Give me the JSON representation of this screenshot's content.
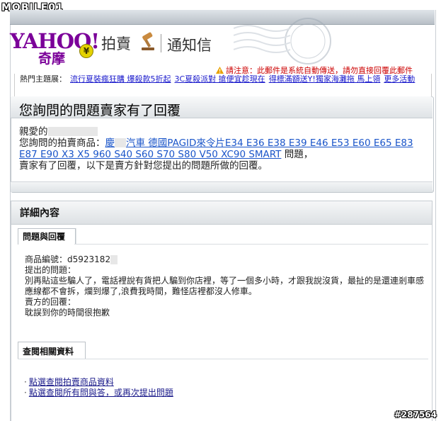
{
  "watermark": {
    "top": "MOBILE01",
    "bottom": "#287564"
  },
  "header": {
    "logo_text": "YAHOO!",
    "logo_cn": "奇摩",
    "logo_badge": "¥",
    "title_1": "拍賣",
    "title_2": "通知信",
    "notice": "請注意：此郵件是系統自動傳送，請勿直接回覆此郵件"
  },
  "hot_topics": {
    "label": "熱門主題展：",
    "links": [
      "流行夏裝瘋狂購 爆殺款5折起",
      "3C夏殺派對 搶便宜趁現在",
      "得標滿額送Y!獨家海灘拖 馬上領"
    ],
    "more": "更多活動"
  },
  "panel1": {
    "title": "您詢問的問題賣家有了回覆",
    "greeting": "親愛的",
    "line2_prefix": "您詢問的拍賣商品：",
    "item_link_a": "慶",
    "item_link_b": "汽車 德國PAGID來令片E34 E36 E38 E39 E46 E53 E60 E65 E83 E87 E90 X3 X5 960 S40 S60 S70 S80 V50 XC90 SMART",
    "line2_suffix": " 問題，",
    "line3": "賣家有了回覆，以下是賣方針對您提出的問題所做的回覆。"
  },
  "panel2": {
    "title": "詳細內容",
    "tab_qa": "問題與回覆",
    "item_no_label": "商品編號：",
    "item_no": "d5923182",
    "question_label": "提出的問題：",
    "question": "別再貼這些騙人了，電話裡說有貨把人騙到你店裡，等了一個多小時，才跟我說沒貨，最扯的是還連剎車感應線都不會拆，爛到爆了,浪費我時間，難怪店裡都沒人修車。",
    "answer_label": "賣方的回覆：",
    "answer": "耽誤到你的時間很抱歉",
    "tab_info": "查閱相關資料",
    "link_1": "點選查閱拍賣商品資料",
    "link_2": "點選查閱所有問與答，或再次提出問題",
    "bullet": "·"
  }
}
